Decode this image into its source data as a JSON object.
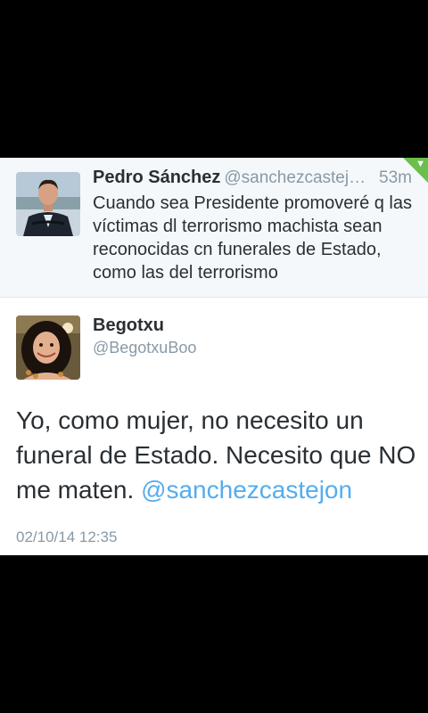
{
  "quoted_tweet": {
    "name": "Pedro Sánchez",
    "handle": "@sanchezcastej…",
    "time": "53m",
    "text": "Cuando sea Presidente promoveré q las víctimas dl terrorismo machista sean reconocidas cn funerales de Estado, como las del terrorismo",
    "avatar_icon": "profile-photo-man-suit"
  },
  "main_tweet": {
    "name": "Begotxu",
    "handle": "@BegotxuBoo",
    "text_body": "Yo, como mujer, no necesito un funeral de Estado. Necesito que NO me maten.",
    "mention": "@sanchezcastejon",
    "date": "02/10/14 12:35",
    "avatar_icon": "profile-photo-woman-curly-hair"
  },
  "colors": {
    "background": "#000000",
    "card": "#ffffff",
    "quoted_bg": "#f5f8fa",
    "link": "#55acee",
    "muted": "#8899a6",
    "text": "#292f33",
    "flag": "#6bbf4e"
  }
}
